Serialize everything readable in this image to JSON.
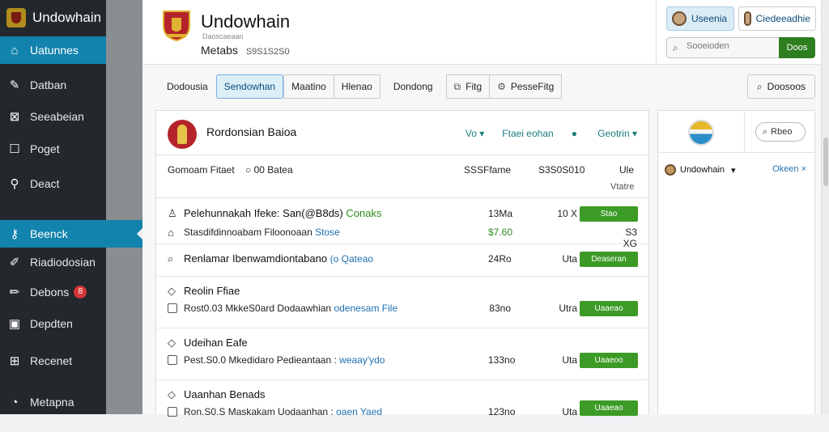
{
  "sidebar": {
    "brand": "Undowhain",
    "items": [
      {
        "label": "Uatunnes",
        "icon": "home-icon",
        "active": true
      },
      {
        "label": "Datban",
        "icon": "brush-icon"
      },
      {
        "label": "Seeabeian",
        "icon": "puzzle-icon"
      },
      {
        "label": "Poget",
        "icon": "page-icon"
      },
      {
        "label": "Deact",
        "icon": "wrench-icon"
      },
      {
        "label": "Beenck",
        "icon": "key-icon",
        "active": true
      },
      {
        "label": "Riadiodosian",
        "icon": "pin-icon"
      },
      {
        "label": "Debons",
        "icon": "pencil-icon",
        "badge": "8"
      },
      {
        "label": "Depdten",
        "icon": "archive-icon"
      },
      {
        "label": "Recenet",
        "icon": "grid-icon"
      },
      {
        "label": "Metapna",
        "icon": "gauge-icon"
      }
    ]
  },
  "header": {
    "title": "Undowhain",
    "subtitle": "Daoscaeaan",
    "meta_label": "Metabs",
    "meta_value": "S9S1S2S0"
  },
  "header_right": {
    "user1": "Useenia",
    "user2": "Ciedeeadhie",
    "search_placeholder": "Sooeioden",
    "search_button": "Doos"
  },
  "tabs": [
    {
      "label": "Dodousia"
    },
    {
      "label": "Sendowhan",
      "active": true
    },
    {
      "label": "Maatino",
      "box": true
    },
    {
      "label": "Hlenao",
      "box": true
    },
    {
      "label": "Dondong"
    },
    {
      "label": "Fitg",
      "icon": "copy-icon",
      "box": true
    },
    {
      "label": "PesseFitg",
      "icon": "gear-icon",
      "box": true
    }
  ],
  "tab_right": "Doosoos",
  "card": {
    "title": "Rordonsian Baioa",
    "action1": "Vo",
    "action2": "Ftaei eohan",
    "action3": "Geotrin"
  },
  "columns": {
    "name": "Gomoam Fitaet",
    "status": "00 Batea",
    "size": "SSSFfame",
    "count": "S3S0S010",
    "type": "Ule",
    "type_sub": "Vtatre"
  },
  "rows": [
    {
      "title": "Pelehunnakah Ifeke: San(@B8ds) ",
      "title_tag": "Conaks",
      "sub": "Stasdifdinnoabam Filoonoaan ",
      "sub_link": "Stose",
      "size": "13Ma",
      "size2": "$7.60",
      "unit": "10 X",
      "unit2": "S3 XG",
      "btn": "Stao"
    },
    {
      "title": "Renlamar Ibenwamdiontabano ",
      "title_link": "(o Qateao",
      "size": "24Ro",
      "unit": "Uta",
      "btn": "Deaseran"
    },
    {
      "title": "Reolin Ffiae",
      "sub": "Rost0.03 MkkeS0ard Dodaawhian ",
      "sub_link": "odenesam File",
      "size": "83no",
      "unit": "Utra",
      "btn": "Uaaeao"
    },
    {
      "title": "Udeihan Eafe",
      "sub": "Pest.S0.0 Mkedidaro Pedieantaan : ",
      "sub_link": "weaay'ydo",
      "size": "133no",
      "unit": "Uta",
      "btn": "Uaaeoo"
    },
    {
      "title": "Uaanhan Benads",
      "sub": "Ron.S0.S Maskakam Uodaanhan : ",
      "sub_link": "oaen Yaed",
      "size": "123no",
      "unit": "Uta",
      "btn": "Uaaeao"
    }
  ],
  "panel": {
    "search": "Rbeo",
    "user": "Undowhain",
    "close": "Okeen"
  }
}
